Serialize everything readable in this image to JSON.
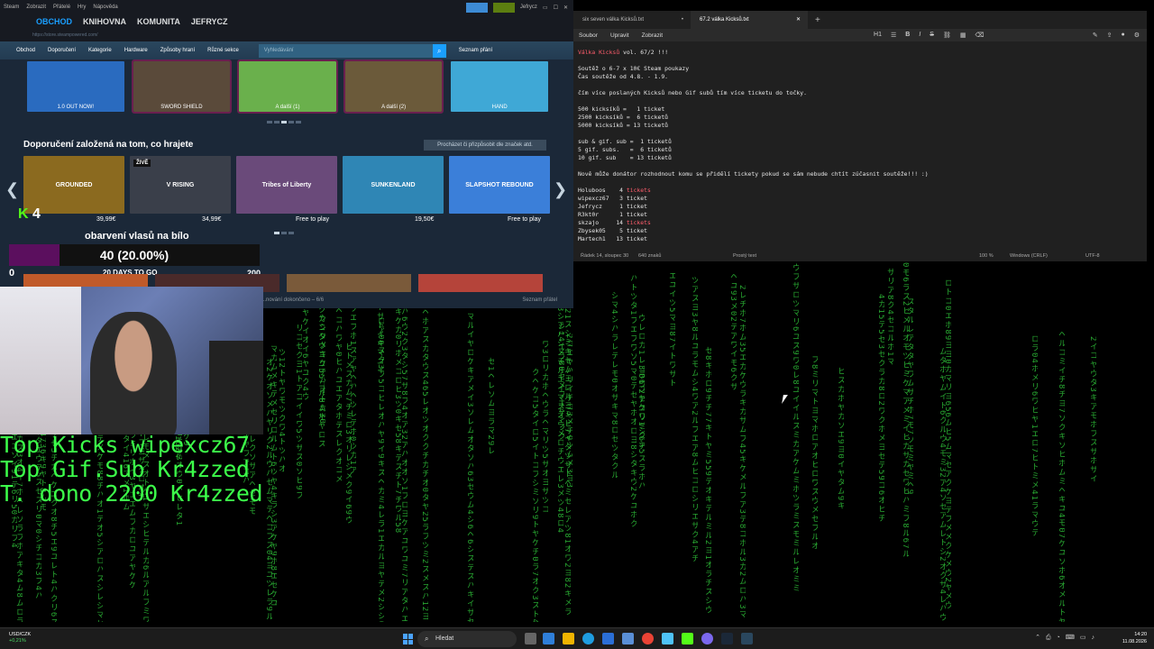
{
  "steam": {
    "titlebar": {
      "items": [
        "Steam",
        "Zobrazit",
        "Přátelé",
        "Hry",
        "Nápověda"
      ],
      "user": "Jefrycz"
    },
    "nav": [
      "OBCHOD",
      "KNIHOVNA",
      "KOMUNITA",
      "JEFRYCZ"
    ],
    "url": "https://store.steampowered.com/",
    "store_menu": [
      "Obchod",
      "Doporučení",
      "Kategorie",
      "Hardware",
      "Způsoby hraní",
      "Různé sekce"
    ],
    "search_placeholder": "Vyhledávání",
    "wishlist": "Seznam přání",
    "top_tiles": [
      {
        "label": "1.0 OUT NOW!",
        "color": "#2a6bbf"
      },
      {
        "label": "SWORD SHIELD",
        "color": "#5a4a3a"
      },
      {
        "label": "A další (1)",
        "color": "#6ab04c"
      },
      {
        "label": "A další (2)",
        "color": "#6b5a3a"
      },
      {
        "label": "HAND",
        "color": "#3fa8d6"
      }
    ],
    "section_title": "Doporučení založená na tom, co hrajete",
    "section_button": "Procházet či přizpůsobit dle značek atd.",
    "games": [
      {
        "name": "GROUNDED",
        "price": "39,99€",
        "color": "#8b6a1f"
      },
      {
        "name": "V RISING",
        "price": "34,99€",
        "color": "#3a3f4a",
        "badge": "ŽIVĚ"
      },
      {
        "name": "Tribes of Liberty",
        "price": "Free to play",
        "color": "#6a4a7a"
      },
      {
        "name": "SUNKENLAND",
        "price": "19,50€",
        "color": "#2f86b5"
      },
      {
        "name": "SLAPSHOT REBOUND",
        "price": "Free to play",
        "color": "#3b7fd9"
      }
    ],
    "status": "...nování dokončeno – 6/6",
    "friends": "Seznam přátel"
  },
  "goal": {
    "title": "obarvení vlasů na bílo",
    "progress_label": "40 (20.00%)",
    "progress_fraction": 0.2,
    "min": "0",
    "max": "200",
    "days": "20 DAYS TO GO",
    "score": "4"
  },
  "stats": {
    "line1": "Top Kicks wipexcz67",
    "line2": "Top Gif.Sub Kr4zzed",
    "line3": "T. dono 2200 Kr4zzed"
  },
  "notepad": {
    "tabs": [
      "six seven válka Kicksů.txt",
      "67.2 válka Kicksů.txt"
    ],
    "menu": [
      "Soubor",
      "Upravit",
      "Zobrazit"
    ],
    "heading_menu": "H1",
    "lines": [
      "Válka Kicksů vol. 67/2 !!!",
      "",
      "Soutěž o 6-7 x 10€ Steam poukazy",
      "Čas soutěže od 4.8. - 1.9.",
      "",
      "čím více poslaných Kicksů nebo Gif subů tím více ticketu do točky.",
      "",
      "500 kicksíků =   1 ticket",
      "2500 kicksíků =  6 ticketů",
      "5000 kicksíků = 13 ticketů",
      "",
      "sub & gif. sub =  1 ticketů",
      "5 gif. subs.   =  6 ticketů",
      "10 gif. sub    = 13 ticketů",
      "",
      "Nově může donátor rozhodnout komu se přidělí tickety pokud se sám nebude chtít zúčasnit soutěže!!! :)",
      "",
      "Holuboos    4 tickets",
      "wipexcz67   3 ticket",
      "Jefrycz     1 ticket",
      "R3kt0r      1 ticket",
      "skzajo     14 tickets",
      "Zbysek05    5 ticket",
      "Martech1   13 ticket"
    ],
    "status": {
      "position": "Řádek 14, sloupec 30",
      "chars": "640 znaků",
      "format": "Prostý text",
      "zoom": "100 %",
      "eol": "Windows (CRLF)",
      "encoding": "UTF-8"
    }
  },
  "taskbar": {
    "ticker_name": "USD/CZK",
    "ticker_change": "+0,21%",
    "search": "Hledat",
    "time": "14:20",
    "date": "11.08.2026"
  }
}
